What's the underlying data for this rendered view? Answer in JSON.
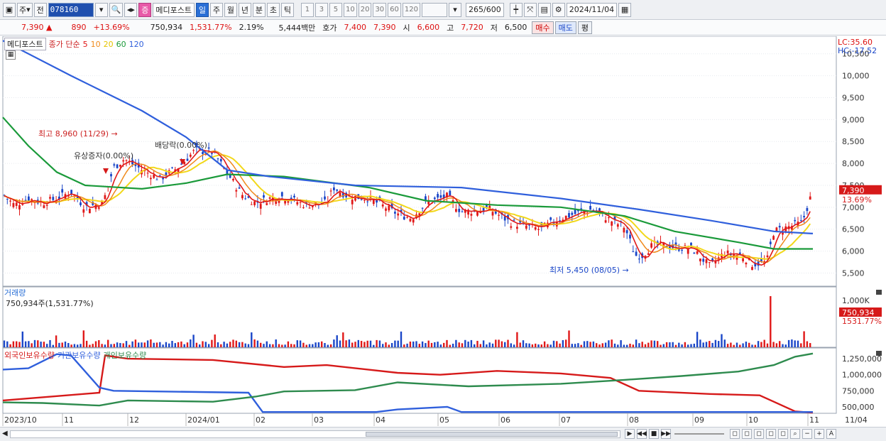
{
  "toolbar": {
    "market": "주",
    "prev": "전",
    "code": "078160",
    "badge": "증",
    "stock_name": "메디포스트",
    "periods": [
      "일",
      "주",
      "월",
      "년",
      "분",
      "초",
      "틱"
    ],
    "active_period": "일",
    "intervals": [
      "1",
      "3",
      "5",
      "10",
      "20",
      "30",
      "60",
      "120"
    ],
    "count": "265",
    "total": "/600",
    "date": "2024/11/04"
  },
  "info": {
    "price": "7,390",
    "change": "890",
    "change_pct": "+13.69%",
    "volume": "750,934",
    "volume_pct": "1,531.77%",
    "turnover": "2.19%",
    "amount": "5,444백만",
    "quote_label": "호가",
    "ask": "7,400",
    "bid": "7,390",
    "open_label": "시",
    "open": "6,600",
    "high_label": "고",
    "high": "7,720",
    "low_label": "저",
    "low": "6,500",
    "buy_btn": "매수",
    "sell_btn": "매도",
    "eval_btn": "평"
  },
  "price_legend": {
    "name": "메디포스트",
    "ma_label": "종가 단순",
    "ma": [
      "5",
      "10",
      "20",
      "60",
      "120"
    ],
    "ma_colors": [
      "#e01818",
      "#f08a1c",
      "#f2d81a",
      "#1a9a3a",
      "#2f5fdc"
    ]
  },
  "price_axis": [
    "10,500",
    "10,000",
    "9,500",
    "9,000",
    "8,500",
    "8,000",
    "7,500",
    "7,000",
    "6,500",
    "6,000",
    "5,500"
  ],
  "lc": "LC:35.60",
  "hc": "HC:-17.52",
  "last_price_tag": "7,390",
  "last_pct_tag": "13.69%",
  "annotations": {
    "high": "최고 8,960 (11/29)",
    "low": "최저 5,450 (08/05)",
    "rights": "유상증자(0.00%)",
    "dividend": "배당락(0.00%)"
  },
  "volume_panel": {
    "title": "거래량",
    "value": "750,934주(1,531.77%)",
    "axis_top": "1,000K",
    "tag_value": "750,934",
    "tag_pct": "1531.77%"
  },
  "holding_panel": {
    "legend": [
      "외국인보유수량",
      "기관보유수량",
      "개인보유수량"
    ],
    "colors": [
      "#d61a1a",
      "#2f5fdc",
      "#2e8b4e"
    ],
    "axis": [
      "1,250,000",
      "1,000,000",
      "750,000",
      "500,000"
    ]
  },
  "x_axis": [
    "2023/10",
    "11",
    "12",
    "2024/01",
    "02",
    "03",
    "04",
    "05",
    "06",
    "07",
    "08",
    "09",
    "10",
    "11",
    "11/04"
  ],
  "colors": {
    "up": "#e01818",
    "down": "#1a46c8",
    "accent": "#2a6fd6"
  }
}
